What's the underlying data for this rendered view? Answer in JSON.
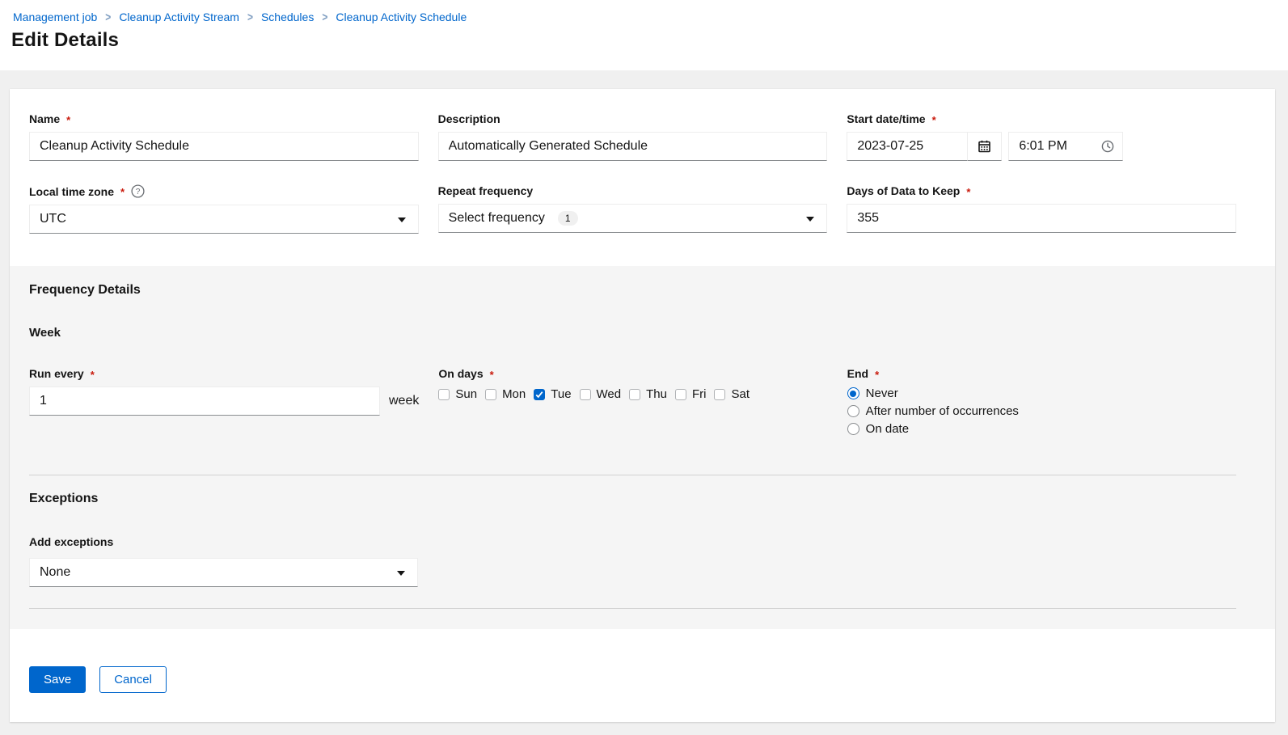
{
  "breadcrumb": {
    "separator": ">",
    "items": [
      {
        "label": "Management job"
      },
      {
        "label": "Cleanup Activity Stream"
      },
      {
        "label": "Schedules"
      },
      {
        "label": "Cleanup Activity Schedule"
      }
    ]
  },
  "page_title": "Edit Details",
  "form": {
    "name": {
      "label": "Name",
      "required": true,
      "value": "Cleanup Activity Schedule"
    },
    "description": {
      "label": "Description",
      "required": false,
      "value": "Automatically Generated Schedule"
    },
    "start_datetime": {
      "label": "Start date/time",
      "required": true,
      "date_value": "2023-07-25",
      "time_value": "6:01 PM"
    },
    "local_time_zone": {
      "label": "Local time zone",
      "required": true,
      "value": "UTC"
    },
    "repeat_frequency": {
      "label": "Repeat frequency",
      "required": false,
      "value": "Select frequency",
      "badge_count": "1"
    },
    "days_of_data": {
      "label": "Days of Data to Keep",
      "required": true,
      "value": "355"
    }
  },
  "frequency_details": {
    "title": "Frequency Details",
    "subtitle": "Week",
    "run_every": {
      "label": "Run every",
      "required": true,
      "value": "1",
      "unit": "week"
    },
    "on_days": {
      "label": "On days",
      "required": true,
      "days": [
        {
          "label": "Sun",
          "checked": false
        },
        {
          "label": "Mon",
          "checked": false
        },
        {
          "label": "Tue",
          "checked": true
        },
        {
          "label": "Wed",
          "checked": false
        },
        {
          "label": "Thu",
          "checked": false
        },
        {
          "label": "Fri",
          "checked": false
        },
        {
          "label": "Sat",
          "checked": false
        }
      ]
    },
    "end": {
      "label": "End",
      "required": true,
      "options": [
        {
          "label": "Never",
          "selected": true
        },
        {
          "label": "After number of occurrences",
          "selected": false
        },
        {
          "label": "On date",
          "selected": false
        }
      ]
    }
  },
  "exceptions": {
    "title": "Exceptions",
    "add_label": "Add exceptions",
    "value": "None"
  },
  "footer": {
    "save_label": "Save",
    "cancel_label": "Cancel"
  },
  "colors": {
    "primary": "#0066cc",
    "required_asterisk": "#c9190b",
    "page_bg": "#f0f0f0",
    "subsection_bg": "#f5f5f5",
    "text": "#151515",
    "icon_grey": "#6a6e73"
  }
}
